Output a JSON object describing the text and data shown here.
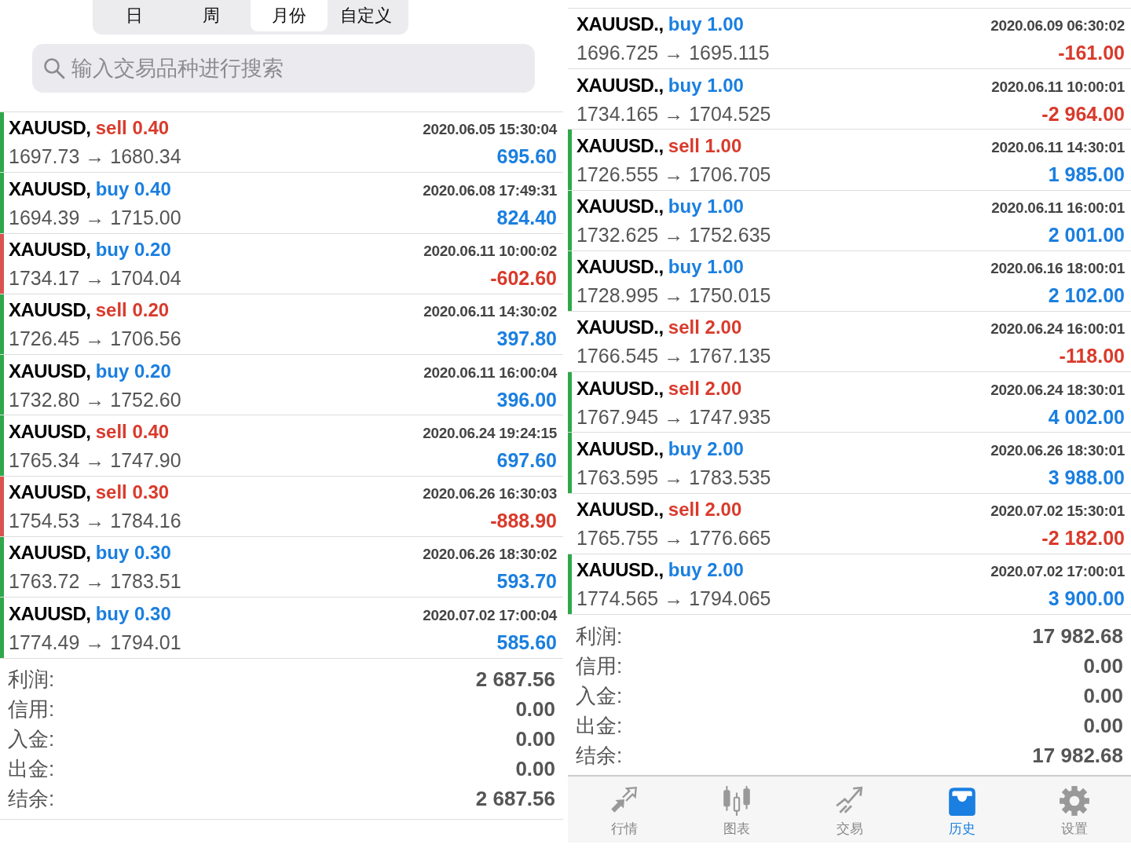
{
  "left_panel": {
    "period_tabs": [
      {
        "label": "日",
        "selected": false
      },
      {
        "label": "周",
        "selected": false
      },
      {
        "label": "月份",
        "selected": true
      },
      {
        "label": "自定义",
        "selected": false
      }
    ],
    "search": {
      "placeholder": "输入交易品种进行搜索"
    },
    "deals": [
      {
        "symbol": "XAUUSD,",
        "side": "sell",
        "volume": "0.40",
        "time": "2020.06.05 15:30:04",
        "prices": "1697.73 → 1680.34",
        "profit": "695.60",
        "loss": false,
        "color": "#2ea84a"
      },
      {
        "symbol": "XAUUSD,",
        "side": "buy",
        "volume": "0.40",
        "time": "2020.06.08 17:49:31",
        "prices": "1694.39 → 1715.00",
        "profit": "824.40",
        "loss": false,
        "color": "#2ea84a"
      },
      {
        "symbol": "XAUUSD,",
        "side": "buy",
        "volume": "0.20",
        "time": "2020.06.11 10:00:02",
        "prices": "1734.17 → 1704.04",
        "profit": "-602.60",
        "loss": true,
        "color": "#d9534f"
      },
      {
        "symbol": "XAUUSD,",
        "side": "sell",
        "volume": "0.20",
        "time": "2020.06.11 14:30:02",
        "prices": "1726.45 → 1706.56",
        "profit": "397.80",
        "loss": false,
        "color": "#2ea84a"
      },
      {
        "symbol": "XAUUSD,",
        "side": "buy",
        "volume": "0.20",
        "time": "2020.06.11 16:00:04",
        "prices": "1732.80 → 1752.60",
        "profit": "396.00",
        "loss": false,
        "color": "#2ea84a"
      },
      {
        "symbol": "XAUUSD,",
        "side": "sell",
        "volume": "0.40",
        "time": "2020.06.24 19:24:15",
        "prices": "1765.34 → 1747.90",
        "profit": "697.60",
        "loss": false,
        "color": "#2ea84a"
      },
      {
        "symbol": "XAUUSD,",
        "side": "sell",
        "volume": "0.30",
        "time": "2020.06.26 16:30:03",
        "prices": "1754.53 → 1784.16",
        "profit": "-888.90",
        "loss": true,
        "color": "#d9534f"
      },
      {
        "symbol": "XAUUSD,",
        "side": "buy",
        "volume": "0.30",
        "time": "2020.06.26 18:30:02",
        "prices": "1763.72 → 1783.51",
        "profit": "593.70",
        "loss": false,
        "color": "#2ea84a"
      },
      {
        "symbol": "XAUUSD,",
        "side": "buy",
        "volume": "0.30",
        "time": "2020.07.02 17:00:04",
        "prices": "1774.49 → 1794.01",
        "profit": "585.60",
        "loss": false,
        "color": "#2ea84a"
      }
    ],
    "summary": [
      {
        "label": "利润:",
        "value": "2 687.56"
      },
      {
        "label": "信用:",
        "value": "0.00"
      },
      {
        "label": "入金:",
        "value": "0.00"
      },
      {
        "label": "出金:",
        "value": "0.00"
      },
      {
        "label": "结余:",
        "value": "2 687.56"
      }
    ]
  },
  "right_panel": {
    "deals": [
      {
        "symbol": "XAUUSD.,",
        "side": "buy",
        "volume": "1.00",
        "time": "2020.06.09 06:30:02",
        "prices": "1696.725 → 1695.115",
        "profit": "-161.00",
        "loss": true
      },
      {
        "symbol": "XAUUSD.,",
        "side": "buy",
        "volume": "1.00",
        "time": "2020.06.11 10:00:01",
        "prices": "1734.165 → 1704.525",
        "profit": "-2 964.00",
        "loss": true
      },
      {
        "symbol": "XAUUSD.,",
        "side": "sell",
        "volume": "1.00",
        "time": "2020.06.11 14:30:01",
        "prices": "1726.555 → 1706.705",
        "profit": "1 985.00",
        "loss": false,
        "color": "#2ea84a"
      },
      {
        "symbol": "XAUUSD.,",
        "side": "buy",
        "volume": "1.00",
        "time": "2020.06.11 16:00:01",
        "prices": "1732.625 → 1752.635",
        "profit": "2 001.00",
        "loss": false,
        "color": "#2ea84a"
      },
      {
        "symbol": "XAUUSD.,",
        "side": "buy",
        "volume": "1.00",
        "time": "2020.06.16 18:00:01",
        "prices": "1728.995 → 1750.015",
        "profit": "2 102.00",
        "loss": false,
        "color": "#2ea84a"
      },
      {
        "symbol": "XAUUSD.,",
        "side": "sell",
        "volume": "2.00",
        "time": "2020.06.24 16:00:01",
        "prices": "1766.545 → 1767.135",
        "profit": "-118.00",
        "loss": true
      },
      {
        "symbol": "XAUUSD.,",
        "side": "sell",
        "volume": "2.00",
        "time": "2020.06.24 18:30:01",
        "prices": "1767.945 → 1747.935",
        "profit": "4 002.00",
        "loss": false,
        "color": "#2ea84a"
      },
      {
        "symbol": "XAUUSD.,",
        "side": "buy",
        "volume": "2.00",
        "time": "2020.06.26 18:30:01",
        "prices": "1763.595 → 1783.535",
        "profit": "3 988.00",
        "loss": false,
        "color": "#2ea84a"
      },
      {
        "symbol": "XAUUSD.,",
        "side": "sell",
        "volume": "2.00",
        "time": "2020.07.02 15:30:01",
        "prices": "1765.755 → 1776.665",
        "profit": "-2 182.00",
        "loss": true
      },
      {
        "symbol": "XAUUSD.,",
        "side": "buy",
        "volume": "2.00",
        "time": "2020.07.02 17:00:01",
        "prices": "1774.565 → 1794.065",
        "profit": "3 900.00",
        "loss": false,
        "color": "#2ea84a"
      }
    ],
    "summary": [
      {
        "label": "利润:",
        "value": "17 982.68"
      },
      {
        "label": "信用:",
        "value": "0.00"
      },
      {
        "label": "入金:",
        "value": "0.00"
      },
      {
        "label": "出金:",
        "value": "0.00"
      },
      {
        "label": "结余:",
        "value": "17 982.68"
      }
    ],
    "tab_bar": [
      {
        "kind": "quotes",
        "label": "行情",
        "selected": false
      },
      {
        "kind": "chart",
        "label": "图表",
        "selected": false
      },
      {
        "kind": "trade",
        "label": "交易",
        "selected": false
      },
      {
        "kind": "history",
        "label": "历史",
        "selected": true
      },
      {
        "kind": "settings",
        "label": "设置",
        "selected": false
      }
    ]
  }
}
